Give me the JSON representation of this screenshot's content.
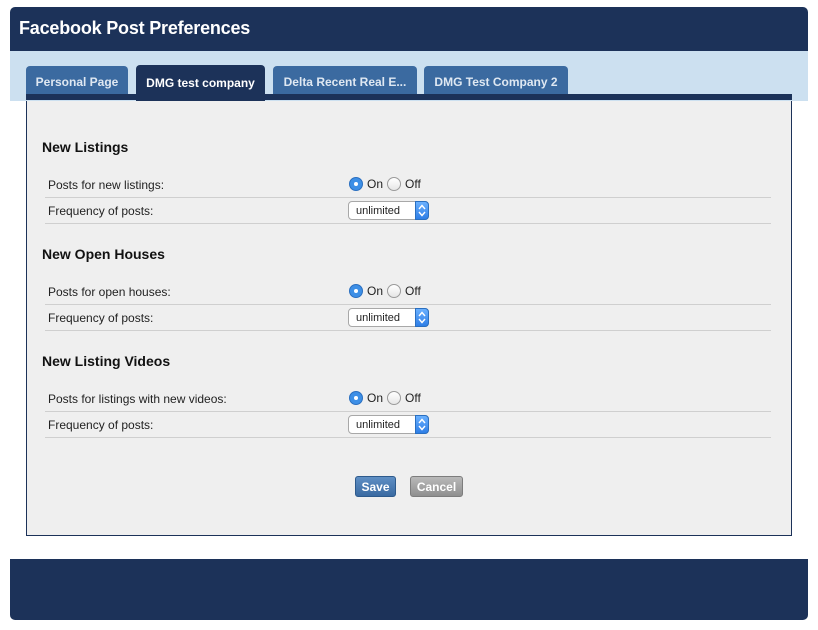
{
  "window": {
    "title": "Facebook Post Preferences"
  },
  "tabs": [
    {
      "label": "Personal Page"
    },
    {
      "label": "DMG test company"
    },
    {
      "label": "Delta Recent Real E..."
    },
    {
      "label": "DMG Test Company 2"
    }
  ],
  "active_tab": "DMG test company",
  "sections": [
    {
      "title": "New Listings",
      "posts_label": "Posts for new listings:",
      "posts_selected": "On",
      "frequency_label": "Frequency of posts:",
      "frequency_value": "unlimited"
    },
    {
      "title": "New Open Houses",
      "posts_label": "Posts for open houses:",
      "posts_selected": "On",
      "frequency_label": "Frequency of posts:",
      "frequency_value": "unlimited"
    },
    {
      "title": "New Listing Videos",
      "posts_label": "Posts for listings with new videos:",
      "posts_selected": "On",
      "frequency_label": "Frequency of posts:",
      "frequency_value": "unlimited"
    }
  ],
  "radio_options": {
    "on": "On",
    "off": "Off"
  },
  "buttons": {
    "save": "Save",
    "cancel": "Cancel"
  },
  "colors": {
    "header_bg": "#1c3259",
    "tab_bar_bg": "#cce0f0",
    "tab_bg": "#3b6aa0",
    "panel_bg": "#efefef",
    "radio_checked": "#3d8fe6"
  }
}
